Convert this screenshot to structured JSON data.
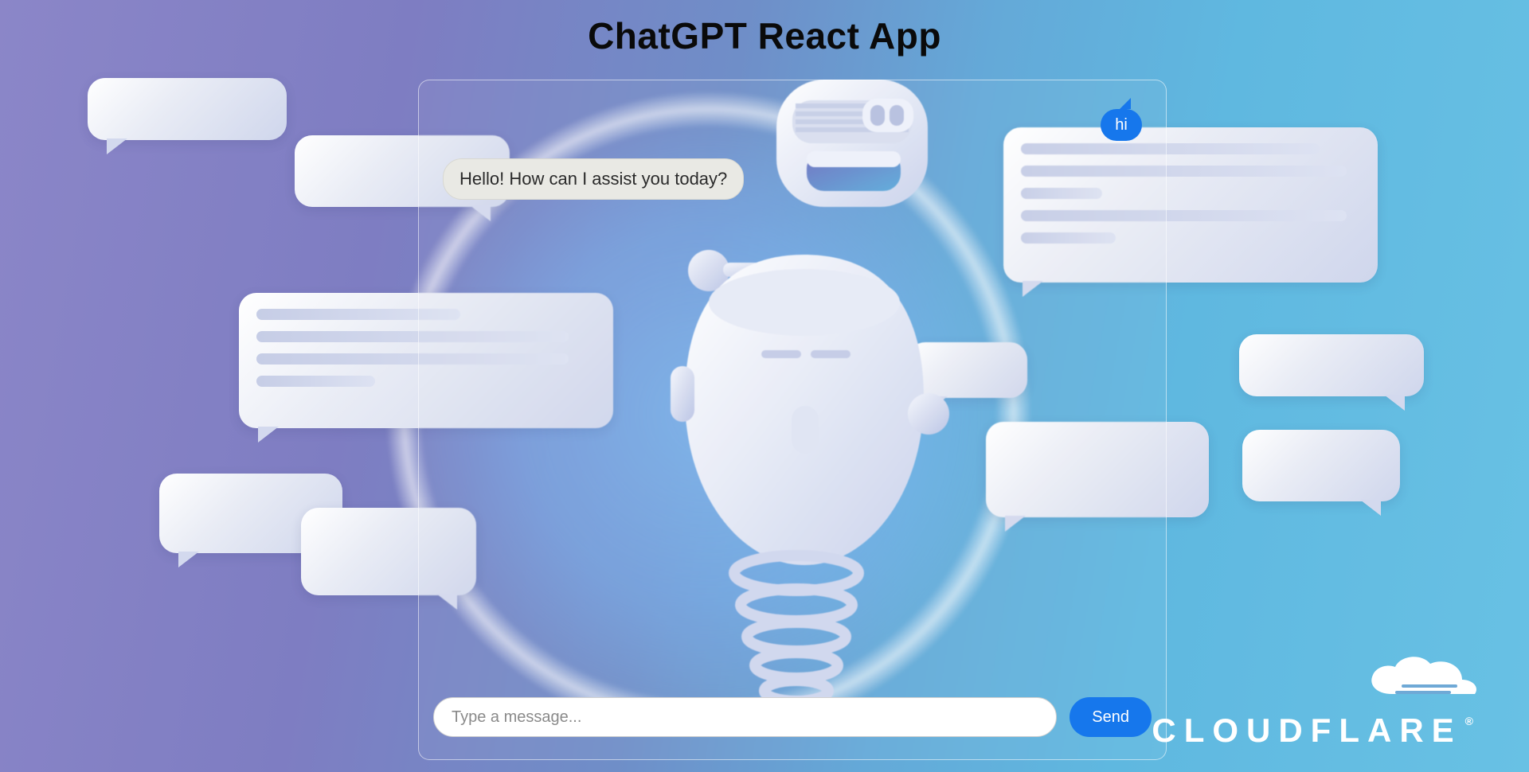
{
  "title": "ChatGPT React App",
  "chat": {
    "user_message": "hi",
    "bot_message": "Hello! How can I assist you today?",
    "input_placeholder": "Type a message...",
    "send_label": "Send"
  },
  "brand": {
    "name": "CLOUDFLARE",
    "registered": "®"
  },
  "colors": {
    "accent": "#1677ec",
    "bot_bubble": "#e9e9e4"
  }
}
